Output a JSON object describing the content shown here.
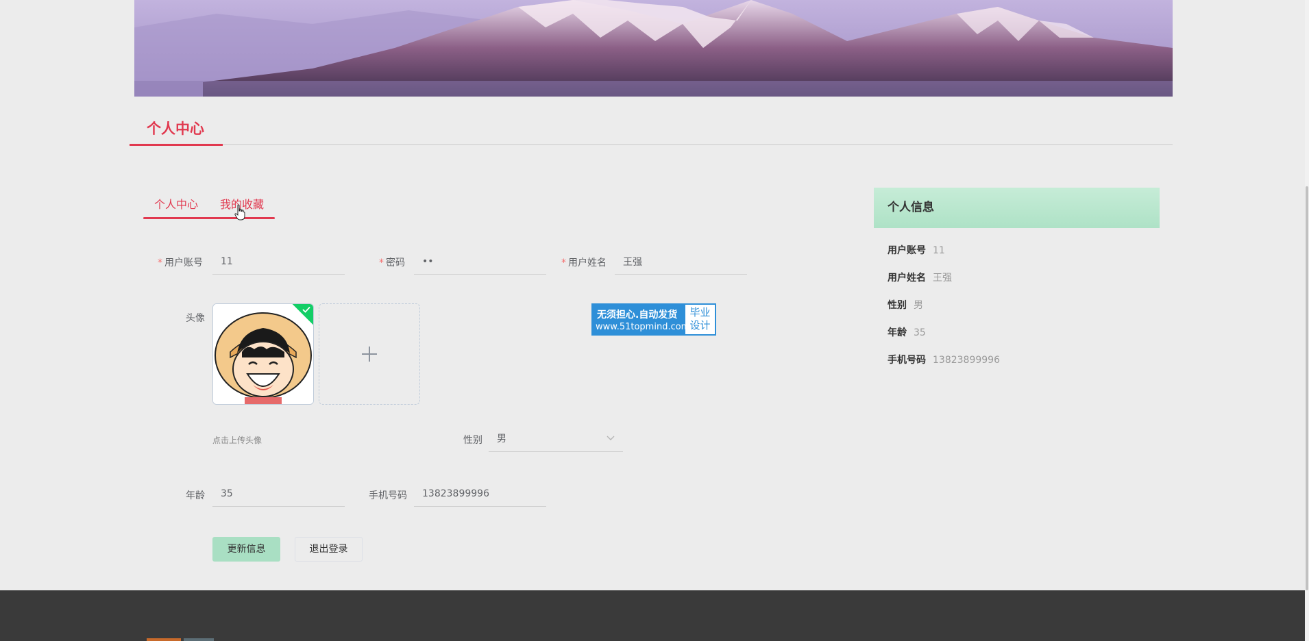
{
  "page": {
    "section_title": "个人中心"
  },
  "tabs": [
    {
      "label": "个人中心"
    },
    {
      "label": "我的收藏"
    }
  ],
  "form": {
    "account": {
      "label": "用户账号",
      "value": "11"
    },
    "password": {
      "label": "密码",
      "value": "••"
    },
    "name": {
      "label": "用户姓名",
      "value": "王强"
    },
    "avatar": {
      "label": "头像",
      "hint": "点击上传头像"
    },
    "gender": {
      "label": "性别",
      "value": "男"
    },
    "age": {
      "label": "年龄",
      "value": "35"
    },
    "phone": {
      "label": "手机号码",
      "value": "13823899996"
    },
    "required_mark": "*"
  },
  "buttons": {
    "update": "更新信息",
    "logout": "退出登录"
  },
  "watermark": {
    "line1": "无须担心.自动发货",
    "line2": "www.51topmind.com",
    "right1": "毕业",
    "right2": "设计"
  },
  "info_panel": {
    "title": "个人信息",
    "rows": [
      {
        "key": "用户账号",
        "value": "11"
      },
      {
        "key": "用户姓名",
        "value": "王强"
      },
      {
        "key": "性别",
        "value": "男"
      },
      {
        "key": "年龄",
        "value": "35"
      },
      {
        "key": "手机号码",
        "value": "13823899996"
      }
    ]
  },
  "colors": {
    "accent": "#e1394f",
    "primary_button": "#a9dfc3",
    "success_badge": "#13ce66",
    "footer": "#3a3a3a"
  }
}
